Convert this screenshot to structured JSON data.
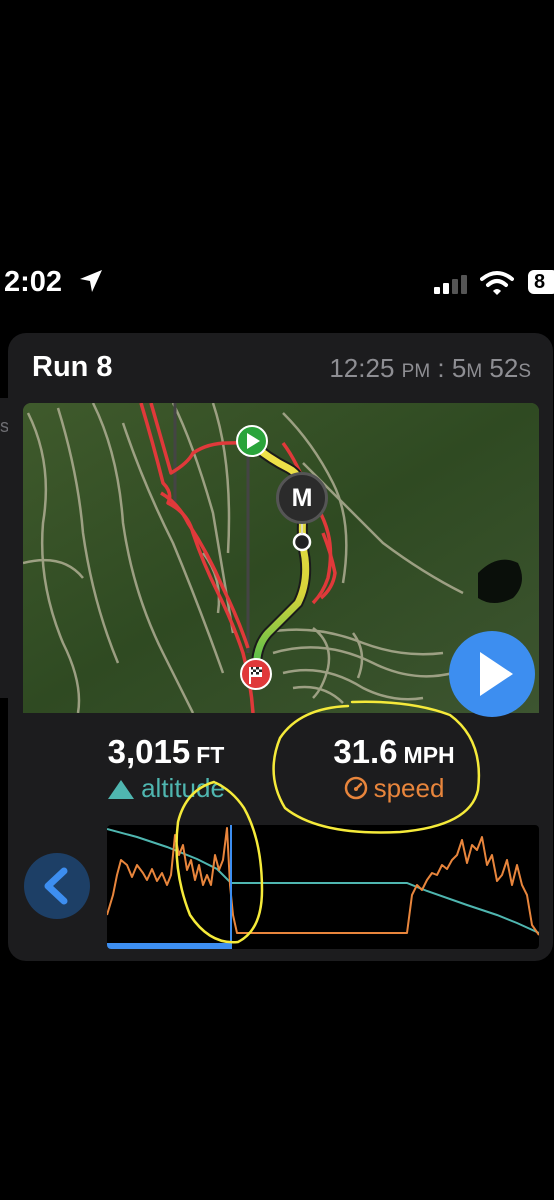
{
  "status_bar": {
    "time": "2:02",
    "battery": "8"
  },
  "side": {
    "label": "s"
  },
  "run": {
    "title": "Run 8",
    "start_time": "12:25",
    "start_time_suffix": "PM",
    "separator": ":",
    "duration_min": "5",
    "duration_min_unit": "M",
    "duration_sec": "52",
    "duration_sec_unit": "S"
  },
  "map": {
    "marker_label": "M"
  },
  "stats": {
    "altitude": {
      "value": "3,015",
      "unit": "FT",
      "label": "altitude"
    },
    "speed": {
      "value": "31.6",
      "unit": "MPH",
      "label": "speed"
    }
  },
  "colors": {
    "altitude": "#4fb6b0",
    "speed": "#e8853c",
    "accent": "#3d8ef0",
    "highlight": "#f5ea3a"
  },
  "icons": {
    "location": "location-arrow-icon",
    "signal": "signal-icon",
    "wifi": "wifi-icon",
    "battery": "battery-icon",
    "play": "play-icon",
    "back": "chevron-left-icon",
    "mountain": "mountain-icon",
    "speedometer": "speedometer-icon",
    "start": "start-flag-icon",
    "finish": "finish-flag-icon"
  },
  "graph": {
    "scrub_position": 0.29
  }
}
